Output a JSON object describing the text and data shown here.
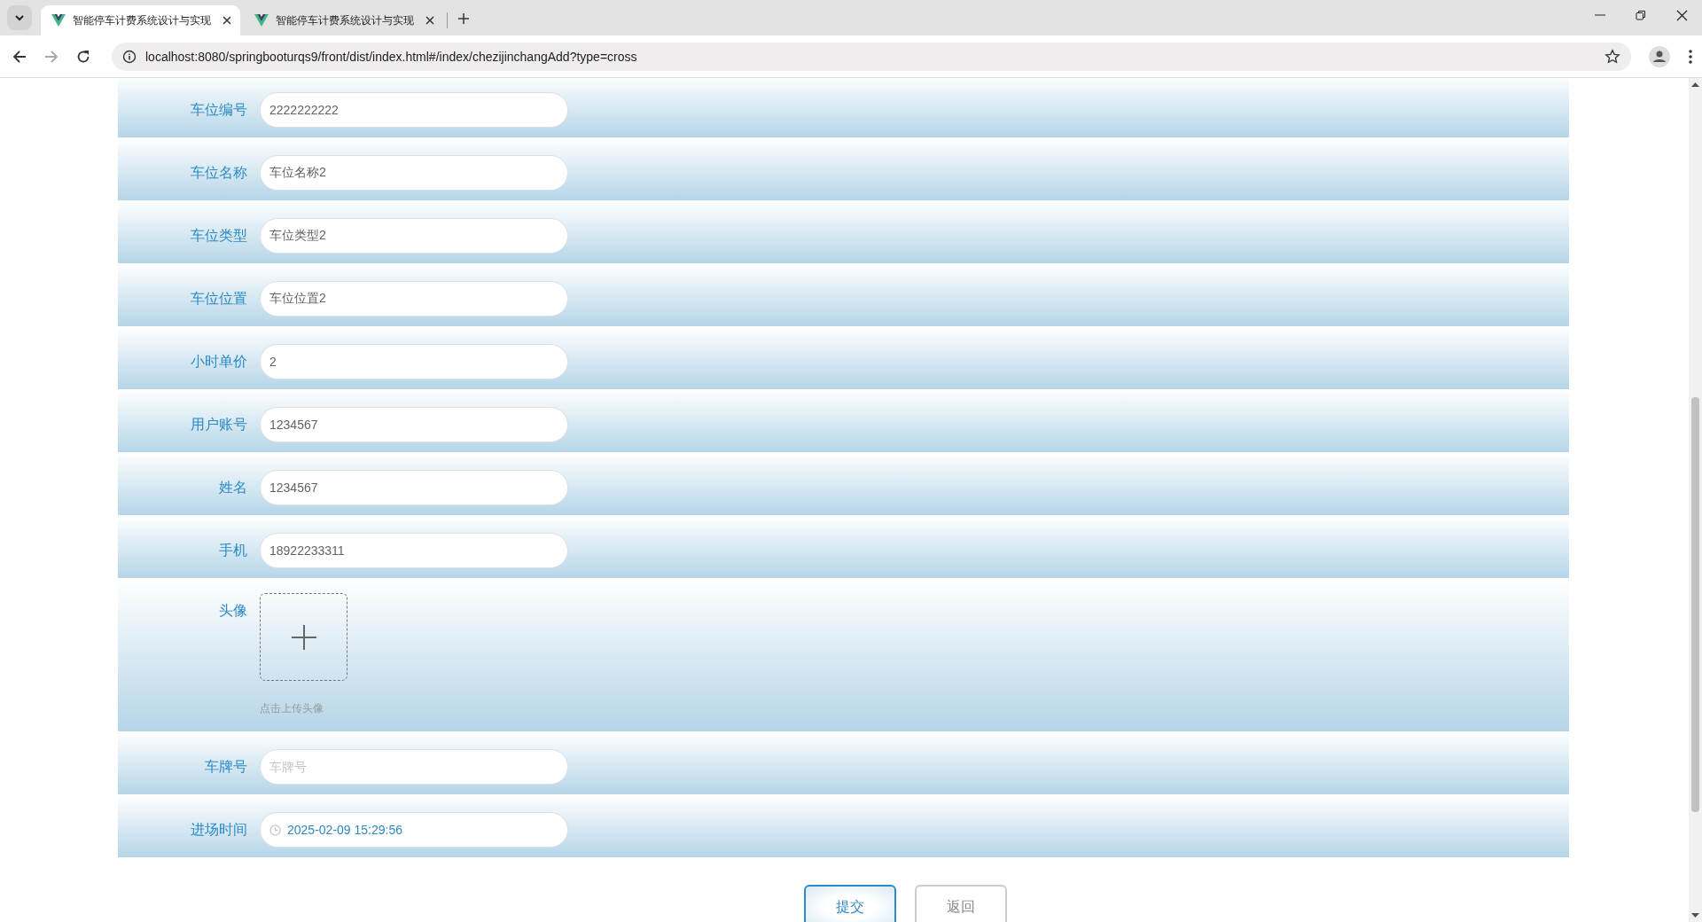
{
  "browser": {
    "tabs": [
      {
        "title": "智能停车计费系统设计与实现",
        "selected": true
      },
      {
        "title": "智能停车计费系统设计与实现",
        "selected": false
      }
    ],
    "url": "localhost:8080/springbooturqs9/front/dist/index.html#/index/chezijinchangAdd?type=cross"
  },
  "form": {
    "fields": [
      {
        "kind": "text",
        "label": "车位编号",
        "value": "2222222222"
      },
      {
        "kind": "text",
        "label": "车位名称",
        "value": "车位名称2"
      },
      {
        "kind": "text",
        "label": "车位类型",
        "value": "车位类型2"
      },
      {
        "kind": "text",
        "label": "车位位置",
        "value": "车位位置2"
      },
      {
        "kind": "text",
        "label": "小时单价",
        "value": "2"
      },
      {
        "kind": "text",
        "label": "用户账号",
        "value": "1234567"
      },
      {
        "kind": "text",
        "label": "姓名",
        "value": "1234567"
      },
      {
        "kind": "text",
        "label": "手机",
        "value": "18922233311"
      },
      {
        "kind": "upload",
        "label": "头像",
        "hint": "点击上传头像"
      },
      {
        "kind": "text",
        "label": "车牌号",
        "placeholder": "车牌号"
      },
      {
        "kind": "datetime",
        "label": "进场时间",
        "value": "2025-02-09 15:29:56"
      }
    ],
    "buttons": [
      {
        "kind": "primary",
        "label": "提交"
      },
      {
        "kind": "secondary",
        "label": "返回"
      }
    ]
  }
}
